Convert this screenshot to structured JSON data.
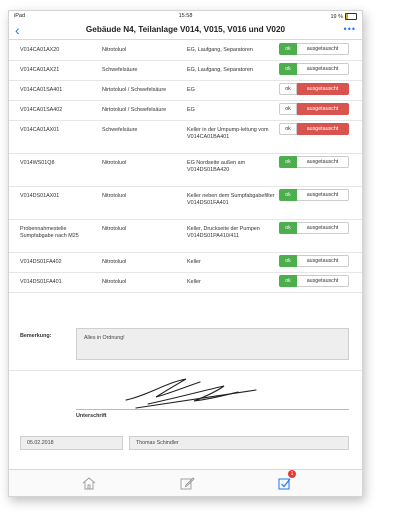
{
  "status": {
    "device": "iPad ",
    "time": "15:58",
    "battery": "19 %",
    "battery_level": 0.19
  },
  "nav": {
    "back_icon": "‹",
    "title": "Gebäude N4, Teilanlage V014, V015, V016 und V020",
    "more_icon": "•••"
  },
  "labels": {
    "ok": "ok",
    "ausgetauscht": "ausgetauscht"
  },
  "rows": [
    {
      "id": "V014CA01AX20",
      "stoff": "Nitrotoluol",
      "ort": "EG, Laufgang, Separatoren",
      "state": "ok"
    },
    {
      "id": "V014CA01AX21",
      "stoff": "Schwefelsäure",
      "ort": "EG, Laufgang, Separatoren",
      "state": "ok"
    },
    {
      "id": "V014CA01SA401",
      "stoff": "Nirtotoluol / Schwefelsäure",
      "ort": "EG",
      "state": "ausgetauscht"
    },
    {
      "id": "V014CA01SA402",
      "stoff": "Nirtotoluol / Schwefelsäure",
      "ort": "EG",
      "state": "ausgetauscht"
    },
    {
      "id": "V014CA01AX01",
      "stoff": "Schwefelsäure",
      "ort": "Keller in der Umpump-leitung vom V014CA01BA401",
      "state": "ausgetauscht"
    },
    {
      "id": "V014WS01Q8",
      "stoff": "Nitrotoluol",
      "ort": "EG Nordseite außen am V014DS01BA420",
      "state": "ok"
    },
    {
      "id": "V014DS01AX01",
      "stoff": "Nitrotoluol",
      "ort": "Keller neben dem Sumpfabgabefilter V014DS01FA401",
      "state": "ok"
    },
    {
      "id": "Probennahmestelle Sumpfabgabe nach M25",
      "stoff": "Nitrotoluol",
      "ort": "Keller, Druckseite der Pumpen V014DS01PA410/411",
      "state": "ok"
    },
    {
      "id": "V014DS01FA402",
      "stoff": "Nitrotoluol",
      "ort": "Keller",
      "state": "ok"
    },
    {
      "id": "V014DS01FA401",
      "stoff": "Nitrotoluol",
      "ort": "Keller",
      "state": "ok"
    }
  ],
  "bemerkung": {
    "label": "Bemerkung:",
    "value": "Alles in Ordnung!"
  },
  "signature": {
    "label": "Unterschrift"
  },
  "footer": {
    "date": "05.02.2018",
    "name": "Thomas Schindler"
  },
  "tabbar": {
    "tabs": [
      "home-icon",
      "edit-icon",
      "checklist-icon"
    ],
    "badge": "1"
  },
  "colors": {
    "accent": "#1877f2",
    "ok_green": "#4cae4c",
    "replaced_red": "#d9534f"
  }
}
